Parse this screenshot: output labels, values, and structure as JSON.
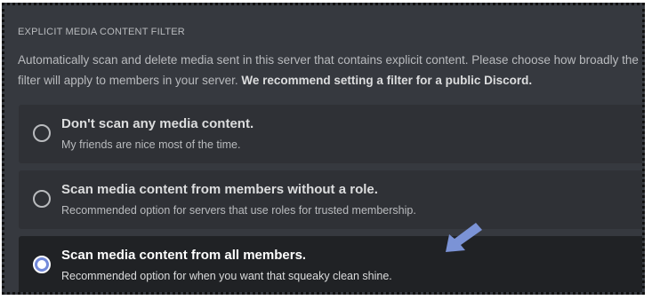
{
  "filter": {
    "section_title": "Explicit Media Content Filter",
    "description_text": "Automatically scan and delete media sent in this server that contains explicit content. Please choose how broadly the filter will apply to members in your server. ",
    "description_bold": "We recommend setting a filter for a public Discord.",
    "options": [
      {
        "title": "Don't scan any media content.",
        "subtitle": "My friends are nice most of the time.",
        "selected": false
      },
      {
        "title": "Scan media content from members without a role.",
        "subtitle": "Recommended option for servers that use roles for trusted membership.",
        "selected": false
      },
      {
        "title": "Scan media content from all members.",
        "subtitle": "Recommended option for when you want that squeaky clean shine.",
        "selected": true
      }
    ]
  },
  "colors": {
    "background": "#36393f",
    "option_background": "#2f3136",
    "selected_option_background": "#202225",
    "accent": "#7289da",
    "pointer_arrow": "#7b93d6"
  },
  "icons": {
    "pointer": "arrow-pointer-icon"
  }
}
